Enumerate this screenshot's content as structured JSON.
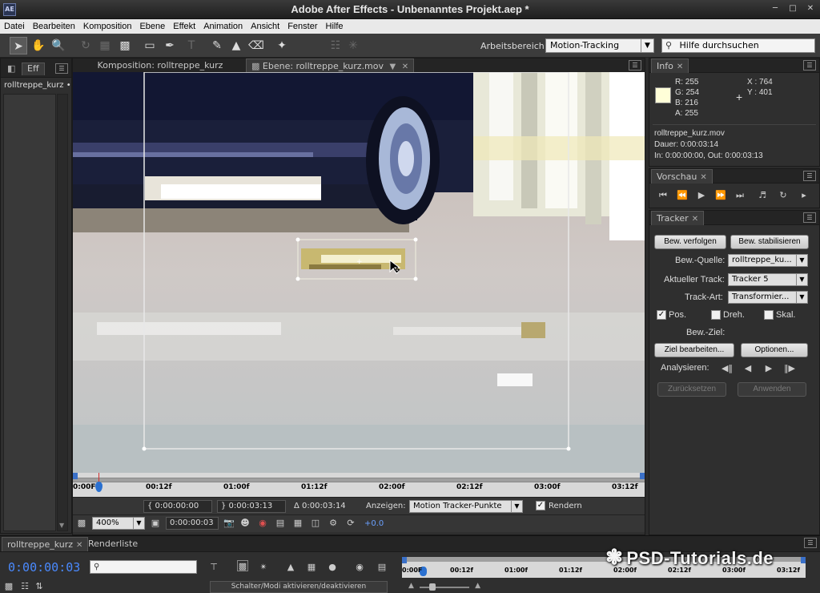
{
  "app": {
    "title": "Adobe After Effects - Unbenanntes Projekt.aep *",
    "logo": "AE"
  },
  "menu": [
    "Datei",
    "Bearbeiten",
    "Komposition",
    "Ebene",
    "Effekt",
    "Animation",
    "Ansicht",
    "Fenster",
    "Hilfe"
  ],
  "toolbar": {
    "workspace_label": "Arbeitsbereich:",
    "workspace_value": "Motion-Tracking",
    "help_placeholder": "Hilfe durchsuchen"
  },
  "left_panel": {
    "tab": "Eff",
    "item": "rolltreppe_kurz •"
  },
  "viewer": {
    "tabs": {
      "comp": "Komposition: rolltreppe_kurz",
      "layer": "Ebene: rolltreppe_kurz.mov"
    },
    "ruler_labels": [
      "0:00F",
      "00:12f",
      "01:00f",
      "01:12f",
      "02:00f",
      "02:12f",
      "03:00f",
      "03:12f"
    ],
    "in_time": "0:00:00:00",
    "out_time": "0:00:03:13",
    "duration": "Δ 0:00:03:14",
    "show_label": "Anzeigen:",
    "show_value": "Motion Tracker-Punkte",
    "render_label": "Rendern",
    "render_checked": true,
    "zoom": "400%",
    "current_time": "0:00:00:03",
    "exposure": "+0.0"
  },
  "info": {
    "tab": "Info",
    "swatch_color": "#fffed8",
    "r": "R:   255",
    "g": "G:   254",
    "b": "B:   216",
    "a": "A:   255",
    "x": "X : 764",
    "y": "Y : 401",
    "file": "rolltreppe_kurz.mov",
    "duration": "Dauer: 0:00:03:14",
    "inout": "In: 0:00:00:00, Out: 0:00:03:13"
  },
  "preview": {
    "tab": "Vorschau"
  },
  "tracker": {
    "tab": "Tracker",
    "btn_track": "Bew. verfolgen",
    "btn_stabilize": "Bew. stabilisieren",
    "source_label": "Bew.-Quelle:",
    "source_value": "rolltreppe_ku...",
    "current_track_label": "Aktueller Track:",
    "current_track_value": "Tracker 5",
    "track_type_label": "Track-Art:",
    "track_type_value": "Transformier...",
    "pos_label": "Pos.",
    "rot_label": "Dreh.",
    "scale_label": "Skal.",
    "pos_checked": true,
    "target_label": "Bew.-Ziel:",
    "btn_edit_target": "Ziel bearbeiten...",
    "btn_options": "Optionen...",
    "analyze_label": "Analysieren:",
    "btn_reset": "Zurücksetzen",
    "btn_apply": "Anwenden"
  },
  "timeline": {
    "tab": "rolltreppe_kurz",
    "tab_render": "Renderliste",
    "current_time": "0:00:00:03",
    "ruler_labels": [
      "0:00F",
      "00:12f",
      "01:00f",
      "01:12f",
      "02:00f",
      "02:12f",
      "03:00f",
      "03:12f"
    ],
    "switch_label": "Schalter/Modi aktivieren/deaktivieren"
  },
  "watermark": "PSD-Tutorials.de"
}
